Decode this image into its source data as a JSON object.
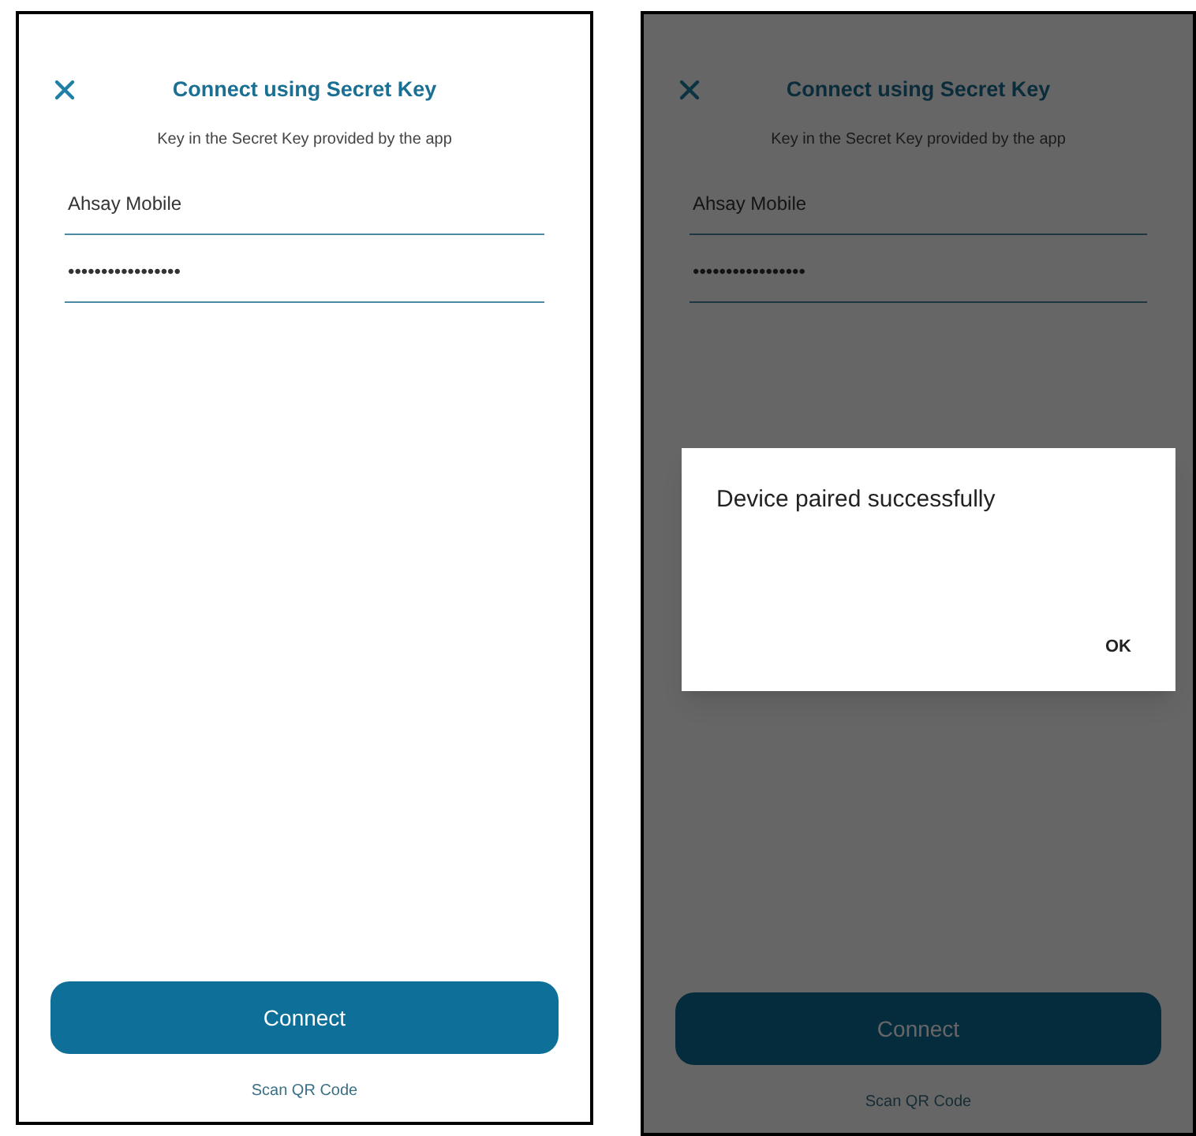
{
  "screens": [
    {
      "dimmed": false,
      "title": "Connect using Secret Key",
      "subtitle": "Key in the Secret Key provided by the app",
      "fields": [
        {
          "value": "Ahsay Mobile"
        },
        {
          "value": "•••••••••••••••••"
        }
      ],
      "connect_button": "Connect",
      "scan_link": "Scan QR Code"
    },
    {
      "dimmed": true,
      "title": "Connect using Secret Key",
      "subtitle": "Key in the Secret Key provided by the app",
      "fields": [
        {
          "value": "Ahsay Mobile"
        },
        {
          "value": "•••••••••••••••••"
        }
      ],
      "connect_button": "Connect",
      "scan_link": "Scan QR Code",
      "dialog": {
        "message": "Device paired successfully",
        "button": "OK"
      }
    }
  ]
}
